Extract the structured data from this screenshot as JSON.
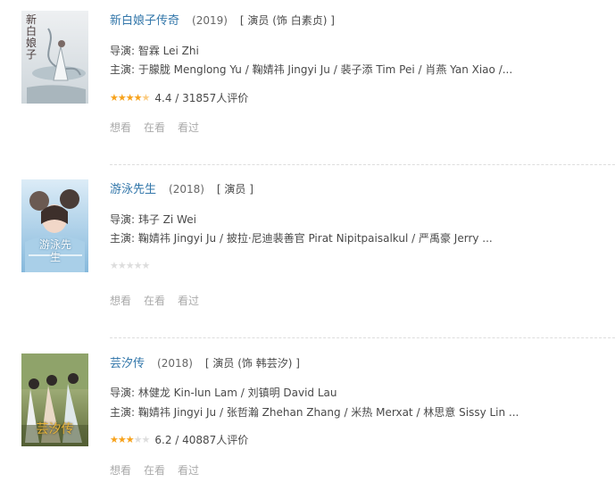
{
  "entries": [
    {
      "title": "新白娘子传奇",
      "year": "(2019)",
      "role": "[ 演员 (饰 白素贞) ]",
      "director": "导演: 智霖 Lei Zhi",
      "cast": "主演: 于朦胧 Menglong Yu / 鞠婧祎 Jingyi Ju / 裴子添 Tim Pei / 肖燕 Yan Xiao /...",
      "rating_value": 4.4,
      "rating_text": "4.4 / 31857人评价",
      "poster_caption": "新白娘子",
      "actions": [
        "想看",
        "在看",
        "看过"
      ],
      "colors": {
        "poster_top": "#e9ecef",
        "poster_bottom": "#c9d1d6"
      }
    },
    {
      "title": "游泳先生",
      "year": "(2018)",
      "role": "[ 演员 ]",
      "director": "导演: 玮子 Zi Wei",
      "cast": "主演: 鞠婧祎 Jingyi Ju / 披拉·尼迪裴善官 Pirat Nipitpaisalkul / 严禹豪 Jerry ...",
      "rating_value": 0,
      "rating_text": "",
      "poster_caption": "游泳先生",
      "actions": [
        "想看",
        "在看",
        "看过"
      ],
      "colors": {
        "poster_top": "#cfe6f4",
        "poster_bottom": "#7fb5d9"
      }
    },
    {
      "title": "芸汐传",
      "year": "(2018)",
      "role": "[ 演员 (饰 韩芸汐) ]",
      "director": "导演: 林健龙 Kin-lun Lam / 刘镇明 David Lau",
      "cast": "主演: 鞠婧祎 Jingyi Ju / 张哲瀚 Zhehan Zhang / 米热 Merxat / 林思意 Sissy Lin ...",
      "rating_value": 3.1,
      "rating_text": "6.2 / 40887人评价",
      "poster_caption": "芸汐传",
      "actions": [
        "想看",
        "在看",
        "看过"
      ],
      "colors": {
        "poster_top": "#b9c98f",
        "poster_bottom": "#5e6b3a"
      }
    }
  ],
  "colors": {
    "link": "#3377aa",
    "star_on": "#f7a21b",
    "star_off": "#dddddd",
    "muted": "#aaaaaa"
  }
}
